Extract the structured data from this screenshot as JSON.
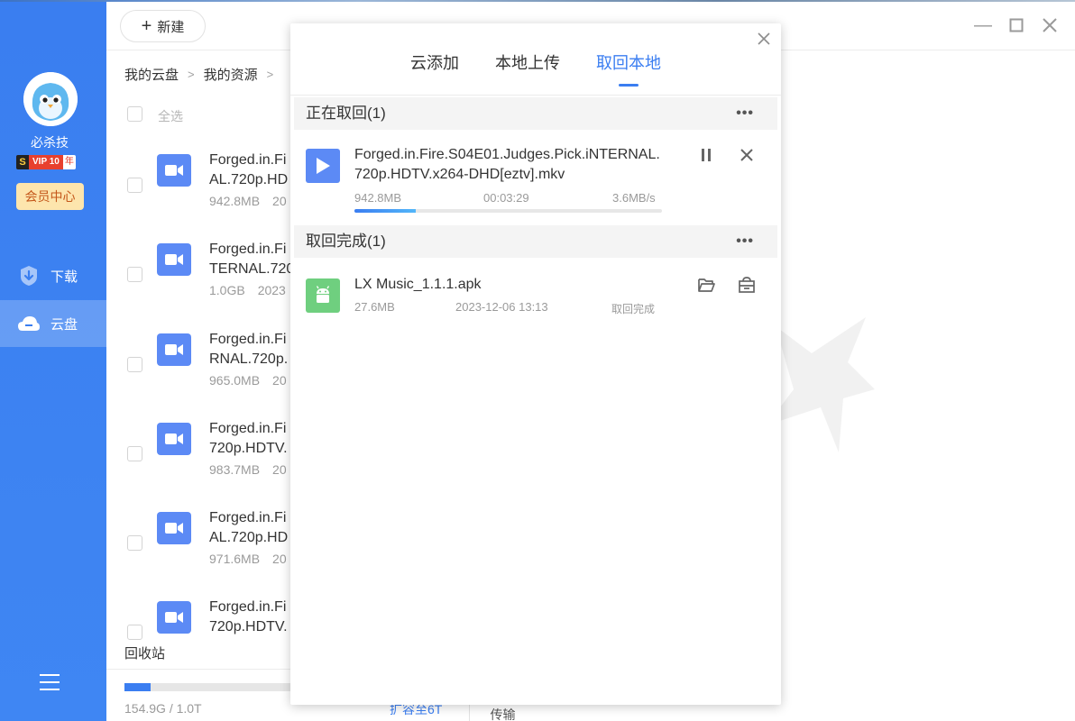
{
  "sidebar": {
    "username": "必杀技",
    "vip": {
      "s": "S",
      "tag": "VIP 10",
      "year": "年"
    },
    "member_center": "会员中心",
    "nav": [
      {
        "label": "下载",
        "icon": "download-shield-icon",
        "active": false
      },
      {
        "label": "云盘",
        "icon": "cloud-icon",
        "active": true
      }
    ]
  },
  "toolbar": {
    "new_label": "新建"
  },
  "breadcrumb": [
    "我的云盘",
    "我的资源"
  ],
  "list": {
    "select_all": "全选",
    "files": [
      {
        "name_line1": "Forged.in.Fi",
        "name_line2": "AL.720p.HD",
        "size": "942.8MB",
        "date": "20"
      },
      {
        "name_line1": "Forged.in.Fi",
        "name_line2": "TERNAL.720",
        "size": "1.0GB",
        "date": "2023"
      },
      {
        "name_line1": "Forged.in.Fi",
        "name_line2": "RNAL.720p.",
        "size": "965.0MB",
        "date": "20"
      },
      {
        "name_line1": "Forged.in.Fi",
        "name_line2": "720p.HDTV.",
        "size": "983.7MB",
        "date": "20"
      },
      {
        "name_line1": "Forged.in.Fi",
        "name_line2": "AL.720p.HD",
        "size": "971.6MB",
        "date": "20"
      },
      {
        "name_line1": "Forged.in.Fi",
        "name_line2": "720p.HDTV.",
        "size": "",
        "date": ""
      }
    ]
  },
  "footer": {
    "recycle": "回收站",
    "storage_text": "154.9G / 1.0T",
    "storage_fraction": 0.15,
    "expand_link": "扩容至6T",
    "transfer_tab": "传输"
  },
  "panel": {
    "tabs": [
      {
        "label": "云添加",
        "active": false
      },
      {
        "label": "本地上传",
        "active": false
      },
      {
        "label": "取回本地",
        "active": true
      }
    ],
    "in_progress": {
      "title": "正在取回(1)",
      "more": "•••",
      "task": {
        "name": "Forged.in.Fire.S04E01.Judges.Pick.iNTERNAL.720p.HDTV.x264-DHD[eztv].mkv",
        "size": "942.8MB",
        "remaining": "00:03:29",
        "speed": "3.6MB/s",
        "progress": 0.2
      }
    },
    "completed": {
      "title": "取回完成(1)",
      "more": "•••",
      "task": {
        "name": "LX Music_1.1.1.apk",
        "size": "27.6MB",
        "time": "2023-12-06 13:13",
        "status": "取回完成"
      }
    }
  },
  "colors": {
    "accent": "#3b7ef1",
    "sidebar": "#3a7ef0",
    "video_icon": "#5c8af5",
    "apk_icon": "#6fcf7f"
  }
}
